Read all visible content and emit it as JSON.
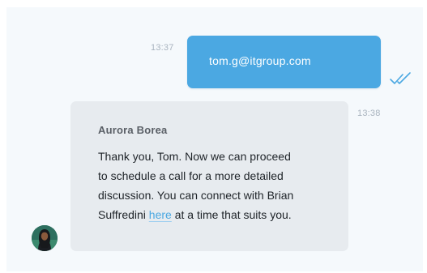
{
  "conversation": {
    "outgoing": {
      "time": "13:37",
      "text": "tom.g@itgroup.com",
      "status_icon": "double-check-icon",
      "bubble_color": "#4ba8e2"
    },
    "incoming": {
      "time": "13:38",
      "sender": "Aurora Borea",
      "lines": [
        "Thank you, Tom. Now we can proceed",
        "to schedule a call for a more detailed",
        "discussion. You can connect with Brian"
      ],
      "last_line_before": "Suffredini ",
      "link_text": "here",
      "last_line_after": " at a time that suits you.",
      "bubble_color": "#e7ebef",
      "avatar_icon": "user-avatar"
    }
  }
}
